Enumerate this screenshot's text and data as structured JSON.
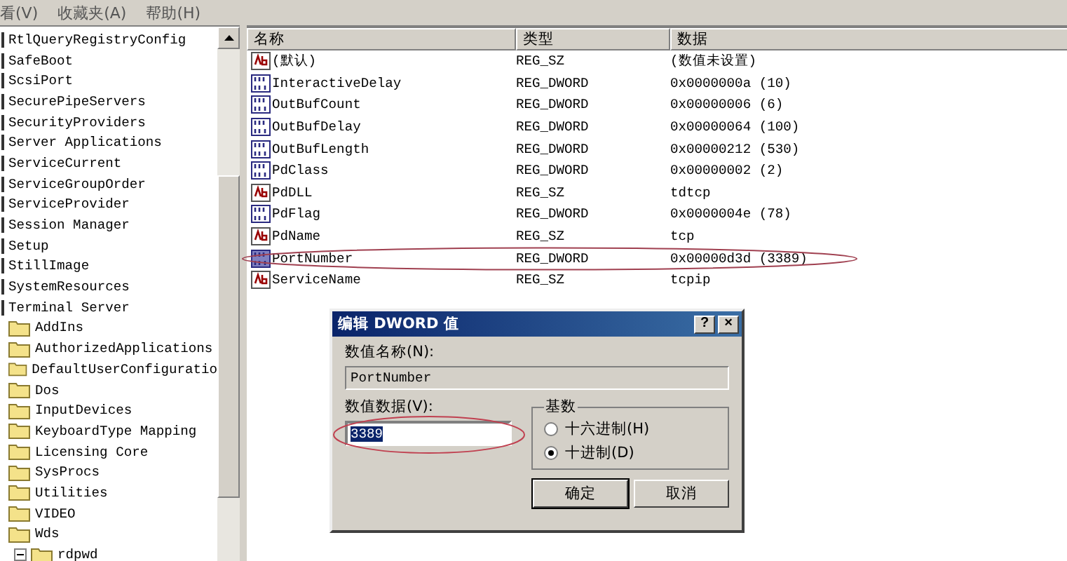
{
  "menu": [
    "看(V)",
    "收藏夹(A)",
    "帮助(H)"
  ],
  "tree": {
    "items": [
      {
        "label": "RtlQueryRegistryConfig"
      },
      {
        "label": "SafeBoot"
      },
      {
        "label": "ScsiPort"
      },
      {
        "label": "SecurePipeServers"
      },
      {
        "label": "SecurityProviders"
      },
      {
        "label": "Server Applications"
      },
      {
        "label": "ServiceCurrent"
      },
      {
        "label": "ServiceGroupOrder"
      },
      {
        "label": "ServiceProvider"
      },
      {
        "label": "Session Manager"
      },
      {
        "label": "Setup"
      },
      {
        "label": "StillImage"
      },
      {
        "label": "SystemResources"
      },
      {
        "label": "Terminal Server",
        "children": [
          {
            "label": "AddIns"
          },
          {
            "label": "AuthorizedApplications"
          },
          {
            "label": "DefaultUserConfiguratio"
          },
          {
            "label": "Dos"
          },
          {
            "label": "InputDevices"
          },
          {
            "label": "KeyboardType Mapping"
          },
          {
            "label": "Licensing Core"
          },
          {
            "label": "SysProcs"
          },
          {
            "label": "Utilities"
          },
          {
            "label": "VIDEO"
          },
          {
            "label": "Wds",
            "children": [
              {
                "label": "rdpwd",
                "expanded": true
              }
            ]
          }
        ]
      }
    ]
  },
  "values": {
    "columns": [
      "名称",
      "类型",
      "数据"
    ],
    "rows": [
      {
        "kind": "string",
        "name": "(默认)",
        "type": "REG_SZ",
        "data": "(数值未设置)",
        "selected": false
      },
      {
        "kind": "dword",
        "name": "InteractiveDelay",
        "type": "REG_DWORD",
        "data": "0x0000000a (10)",
        "selected": false
      },
      {
        "kind": "dword",
        "name": "OutBufCount",
        "type": "REG_DWORD",
        "data": "0x00000006 (6)",
        "selected": false
      },
      {
        "kind": "dword",
        "name": "OutBufDelay",
        "type": "REG_DWORD",
        "data": "0x00000064 (100)",
        "selected": false
      },
      {
        "kind": "dword",
        "name": "OutBufLength",
        "type": "REG_DWORD",
        "data": "0x00000212 (530)",
        "selected": false
      },
      {
        "kind": "dword",
        "name": "PdClass",
        "type": "REG_DWORD",
        "data": "0x00000002 (2)",
        "selected": false
      },
      {
        "kind": "string",
        "name": "PdDLL",
        "type": "REG_SZ",
        "data": "tdtcp",
        "selected": false
      },
      {
        "kind": "dword",
        "name": "PdFlag",
        "type": "REG_DWORD",
        "data": "0x0000004e (78)",
        "selected": false
      },
      {
        "kind": "string",
        "name": "PdName",
        "type": "REG_SZ",
        "data": "tcp",
        "selected": false
      },
      {
        "kind": "dword",
        "name": "PortNumber",
        "type": "REG_DWORD",
        "data": "0x00000d3d (3389)",
        "selected": true
      },
      {
        "kind": "string",
        "name": "ServiceName",
        "type": "REG_SZ",
        "data": "tcpip",
        "selected": false
      }
    ]
  },
  "dialog": {
    "title": "编辑 DWORD 值",
    "help": "?",
    "close": "×",
    "name_label": "数值名称(N):",
    "name_value": "PortNumber",
    "data_label": "数值数据(V):",
    "data_value": "3389",
    "base": {
      "title": "基数",
      "options": [
        {
          "label": "十六进制(H)",
          "selected": false
        },
        {
          "label": "十进制(D)",
          "selected": true
        }
      ]
    },
    "buttons": [
      "确定",
      "取消"
    ]
  }
}
